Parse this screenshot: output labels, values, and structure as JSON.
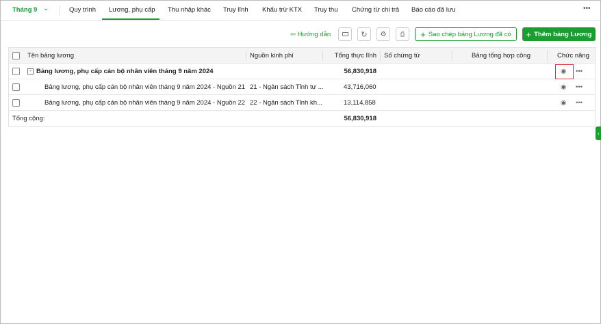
{
  "nav": {
    "month": "Tháng 9",
    "tabs": [
      "Quy trình",
      "Lương, phụ cấp",
      "Thu nhập khác",
      "Truy lĩnh",
      "Khấu trừ KTX",
      "Truy thu",
      "Chứng từ chi trả",
      "Báo cáo đã lưu"
    ],
    "more": "•••"
  },
  "toolbar": {
    "guide": "Hướng dẫn",
    "copy": "Sao chép bảng Lương đã có",
    "add": "Thêm bảng Lương"
  },
  "table": {
    "headers": [
      "Tên bảng lương",
      "Nguồn kinh phí",
      "Tổng thực lĩnh",
      "Số chứng từ",
      "Bảng tổng hợp công",
      "Chức năng"
    ],
    "rows": [
      {
        "name": "Bảng lương, phụ cấp cán bộ nhân viên tháng 9 năm 2024",
        "source": "",
        "total": "56,830,918"
      },
      {
        "name": "Bảng lương, phụ cấp cán bộ nhân viên tháng 9 năm 2024 - Nguồn 21",
        "source": "21 - Ngân sách Tỉnh tự ...",
        "total": "43,716,060"
      },
      {
        "name": "Bảng lương, phụ cấp cán bộ nhân viên tháng 9 năm 2024 - Nguồn 22",
        "source": "22 - Ngân sách Tỉnh kh...",
        "total": "13,114,858"
      }
    ],
    "footer": {
      "label": "Tổng cộng:",
      "total": "56,830,918"
    }
  },
  "colors": {
    "accent": "#1a9e2f",
    "highlight": "#d9363e"
  }
}
